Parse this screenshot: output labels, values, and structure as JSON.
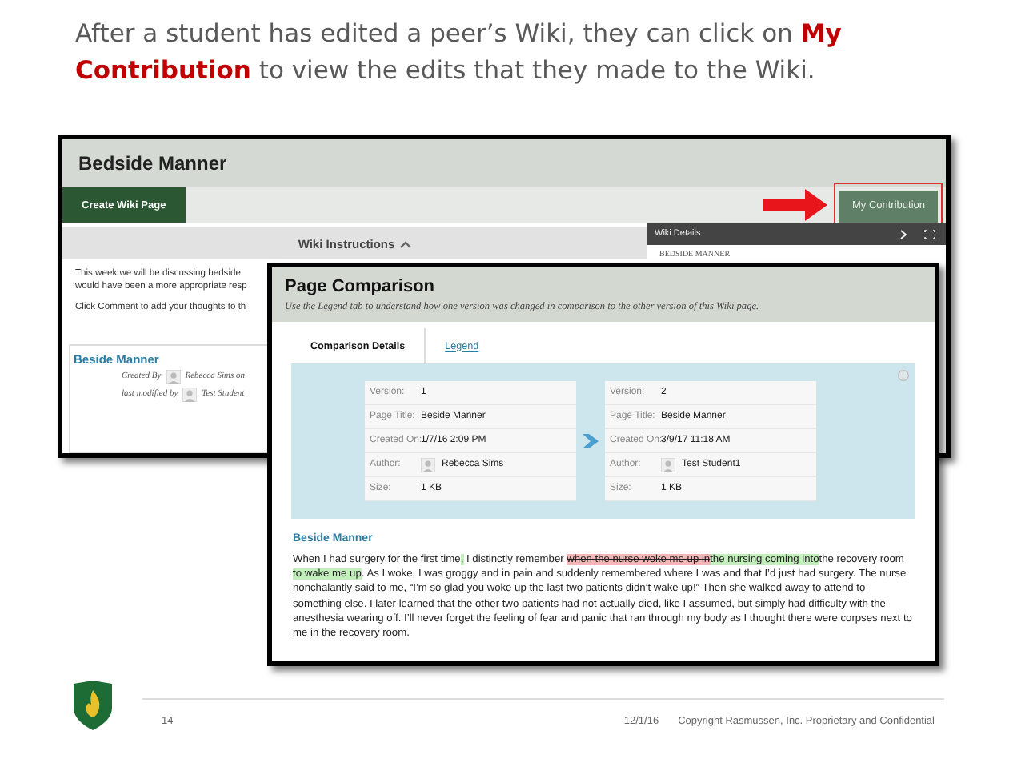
{
  "slide": {
    "title": "After a student has edited a peer’s Wiki, they can click on **My Contribution** to view the edits that they made to the Wiki.",
    "page_number": "14",
    "date": "12/1/16",
    "copyright": "Copyright Rasmussen, Inc. Proprietary and Confidential"
  },
  "wiki_page": {
    "title": "Bedside Manner",
    "create_button": "Create Wiki Page",
    "contribution_button": "My Contribution",
    "instructions_heading": "Wiki Instructions",
    "instructions": [
      {
        "text": "This week we will be discussing bedside"
      },
      {
        "text": "would have been a more appropriate resp"
      },
      {
        "text": "Click Comment to add your thoughts to th"
      }
    ],
    "entry": {
      "title": "Beside Manner",
      "created_label": "Created By",
      "created_name": "Rebecca Sims on",
      "modified_label": "last modified by",
      "modified_name": "Test Student"
    },
    "details": {
      "heading": "Wiki Details",
      "page_name": "BEDSIDE MANNER"
    }
  },
  "comparison": {
    "title": "Page Comparison",
    "subtitle": "Use the Legend tab to understand how one version was changed in comparison to the other version of this Wiki page.",
    "tabs": [
      {
        "label": "Comparison Details",
        "selected": true
      },
      {
        "label": "Legend",
        "selected": false
      }
    ],
    "versions": [
      {
        "rows": [
          {
            "kind": "text",
            "label": "Version:",
            "value": "1"
          },
          {
            "kind": "text",
            "label": "Page Title:",
            "value": "Beside Manner"
          },
          {
            "kind": "text",
            "label": "Created On:",
            "value": "1/7/16 2:09 PM"
          },
          {
            "kind": "person",
            "label": "Author:",
            "value": "Rebecca Sims"
          },
          {
            "kind": "text",
            "label": "Size:",
            "value": "1 KB"
          }
        ]
      },
      {
        "rows": [
          {
            "kind": "text",
            "label": "Version:",
            "value": "2"
          },
          {
            "kind": "text",
            "label": "Page Title:",
            "value": "Beside Manner"
          },
          {
            "kind": "text",
            "label": "Created On:",
            "value": "3/9/17 11:18 AM"
          },
          {
            "kind": "person",
            "label": "Author:",
            "value": "Test Student1"
          },
          {
            "kind": "text",
            "label": "Size:",
            "value": "1 KB"
          }
        ]
      }
    ],
    "body_title": "Beside Manner",
    "body": [
      {
        "kind": "plain",
        "text": "When I had surgery for the first time"
      },
      {
        "kind": "inserted",
        "text": ","
      },
      {
        "kind": "plain",
        "text": " I distinctly remember "
      },
      {
        "kind": "deleted",
        "text": "when the nurse woke me up in"
      },
      {
        "kind": "inserted",
        "text": "the nursing coming into"
      },
      {
        "kind": "plain",
        "text": "the recovery room "
      },
      {
        "kind": "inserted",
        "text": "to wake me up"
      },
      {
        "kind": "plain",
        "text": ". As I woke, I was groggy and in pain and suddenly remembered where I was and that I’d just had surgery. The nurse nonchalantly said to me, “I’m so glad you woke up the last two patients didn’t wake up!” Then she walked away to attend to something else. I later learned that the other two patients had not actually died, like I assumed, but simply had difficulty with the anesthesia wearing off. I’ll never forget the feeling of fear and panic that ran through my body as I thought there were corpses next to me in the recovery room."
      }
    ]
  }
}
